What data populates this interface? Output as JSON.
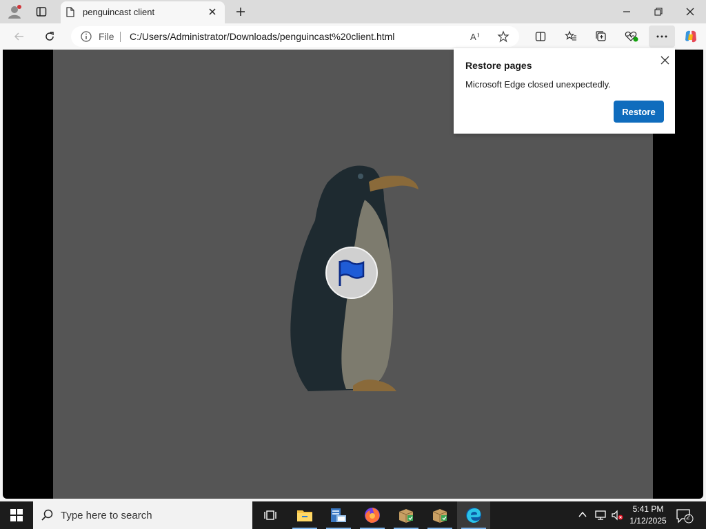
{
  "browser": {
    "tab_title": "penguincast client",
    "file_label": "File",
    "url": "C:/Users/Administrator/Downloads/penguincast%20client.html"
  },
  "popup": {
    "title": "Restore pages",
    "message": "Microsoft Edge closed unexpectedly.",
    "restore_label": "Restore"
  },
  "taskbar": {
    "search_placeholder": "Type here to search",
    "time": "5:41 PM",
    "date": "1/12/2025",
    "notification_count": "2"
  },
  "colors": {
    "accent": "#0f6cbd",
    "stage_bg": "#555555",
    "flag": "#1f5cd6"
  }
}
